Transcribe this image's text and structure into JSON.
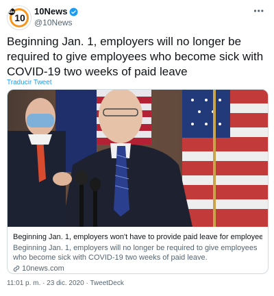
{
  "author": {
    "name": "10News",
    "handle": "@10News",
    "logo_text": "10",
    "logo_corner": "abc"
  },
  "more_label": "•••",
  "tweet": {
    "text": "Beginning Jan. 1, employers will no longer be required to give employees who become sick with COVID-19 two weeks of paid leave",
    "translate_label": "Traducir Tweet"
  },
  "card": {
    "title": "Beginning Jan. 1, employers won't have to provide paid leave for employee...",
    "description": "Beginning Jan. 1, employers will no longer be required to give employees who become sick with COVID-19 two weeks of paid leave.",
    "domain": "10news.com"
  },
  "meta": {
    "timestamp": "11:01 p. m. · 23 dic. 2020 · TweetDeck"
  },
  "colors": {
    "link": "#1d9bf0",
    "verified": "#1d9bf0",
    "logo_orange": "#f7941d"
  }
}
